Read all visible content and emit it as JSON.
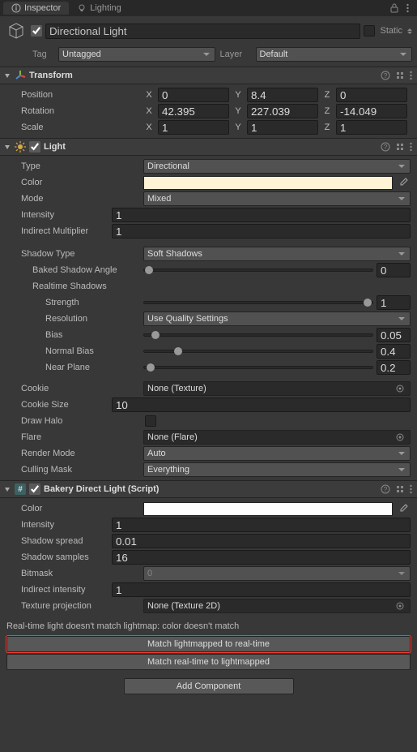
{
  "tabs": {
    "inspector": "Inspector",
    "lighting": "Lighting"
  },
  "header": {
    "name": "Directional Light",
    "static": "Static",
    "tag_label": "Tag",
    "tag_value": "Untagged",
    "layer_label": "Layer",
    "layer_value": "Default"
  },
  "transform": {
    "title": "Transform",
    "position_label": "Position",
    "rotation_label": "Rotation",
    "scale_label": "Scale",
    "x": "X",
    "y": "Y",
    "z": "Z",
    "position": {
      "x": "0",
      "y": "8.4",
      "z": "0"
    },
    "rotation": {
      "x": "42.395",
      "y": "227.039",
      "z": "-14.049"
    },
    "scale": {
      "x": "1",
      "y": "1",
      "z": "1"
    }
  },
  "light": {
    "title": "Light",
    "type_label": "Type",
    "type_value": "Directional",
    "color_label": "Color",
    "color_value": "#fff3d6",
    "mode_label": "Mode",
    "mode_value": "Mixed",
    "intensity_label": "Intensity",
    "intensity_value": "1",
    "indirect_label": "Indirect Multiplier",
    "indirect_value": "1",
    "shadow_type_label": "Shadow Type",
    "shadow_type_value": "Soft Shadows",
    "baked_angle_label": "Baked Shadow Angle",
    "baked_angle_value": "0",
    "baked_angle_pct": 2,
    "realtime_label": "Realtime Shadows",
    "strength_label": "Strength",
    "strength_value": "1",
    "strength_pct": 98,
    "resolution_label": "Resolution",
    "resolution_value": "Use Quality Settings",
    "bias_label": "Bias",
    "bias_value": "0.05",
    "bias_pct": 5,
    "normal_bias_label": "Normal Bias",
    "normal_bias_value": "0.4",
    "normal_bias_pct": 15,
    "near_plane_label": "Near Plane",
    "near_plane_value": "0.2",
    "near_plane_pct": 3,
    "cookie_label": "Cookie",
    "cookie_value": "None (Texture)",
    "cookie_size_label": "Cookie Size",
    "cookie_size_value": "10",
    "draw_halo_label": "Draw Halo",
    "flare_label": "Flare",
    "flare_value": "None (Flare)",
    "render_mode_label": "Render Mode",
    "render_mode_value": "Auto",
    "culling_label": "Culling Mask",
    "culling_value": "Everything"
  },
  "bakery": {
    "title": "Bakery Direct Light (Script)",
    "color_label": "Color",
    "color_value": "#ffffff",
    "intensity_label": "Intensity",
    "intensity_value": "1",
    "spread_label": "Shadow spread",
    "spread_value": "0.01",
    "samples_label": "Shadow samples",
    "samples_value": "16",
    "bitmask_label": "Bitmask",
    "bitmask_value": "0",
    "indirect_label": "Indirect intensity",
    "indirect_value": "1",
    "texproj_label": "Texture projection",
    "texproj_value": "None (Texture 2D)",
    "warning": "Real-time light doesn't match lightmap: color doesn't match",
    "btn1": "Match lightmapped to real-time",
    "btn2": "Match real-time to lightmapped"
  },
  "add_component": "Add Component"
}
